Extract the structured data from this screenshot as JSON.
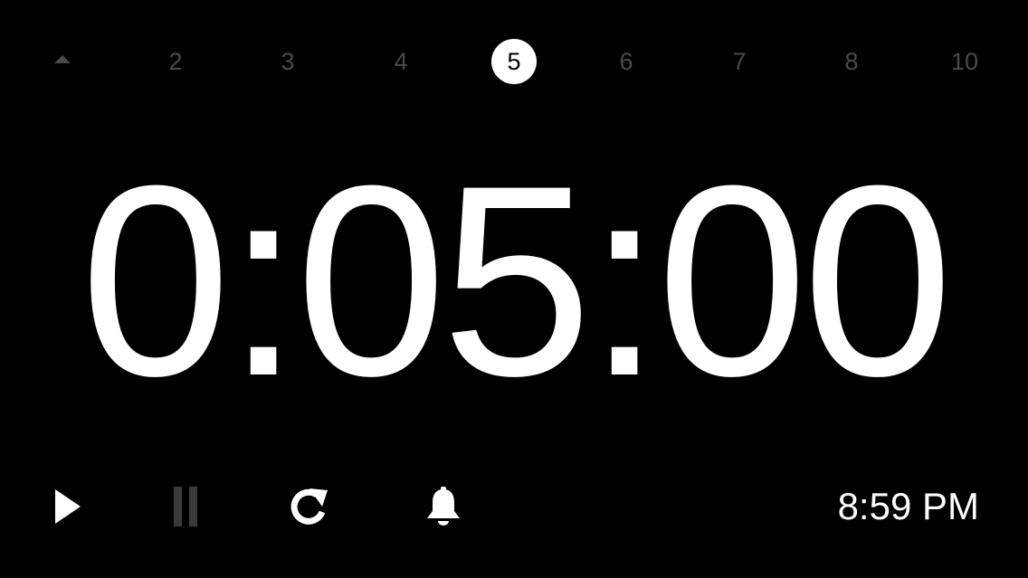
{
  "timer": {
    "display": "0:05:00"
  },
  "presets": {
    "collapse_icon": "caret-up-icon",
    "items": [
      {
        "label": "2"
      },
      {
        "label": "3"
      },
      {
        "label": "4"
      },
      {
        "label": "5",
        "selected": true
      },
      {
        "label": "6"
      },
      {
        "label": "7"
      },
      {
        "label": "8"
      },
      {
        "label": "10"
      }
    ]
  },
  "controls": {
    "play_icon": "play-icon",
    "pause_icon": "pause-icon",
    "reset_icon": "reset-icon",
    "alarm_icon": "bell-icon"
  },
  "clock": {
    "time": "8:59 PM"
  },
  "colors": {
    "background": "#000000",
    "foreground": "#ffffff",
    "inactive": "#4a4a4a",
    "disabled": "#3a3a3a"
  }
}
